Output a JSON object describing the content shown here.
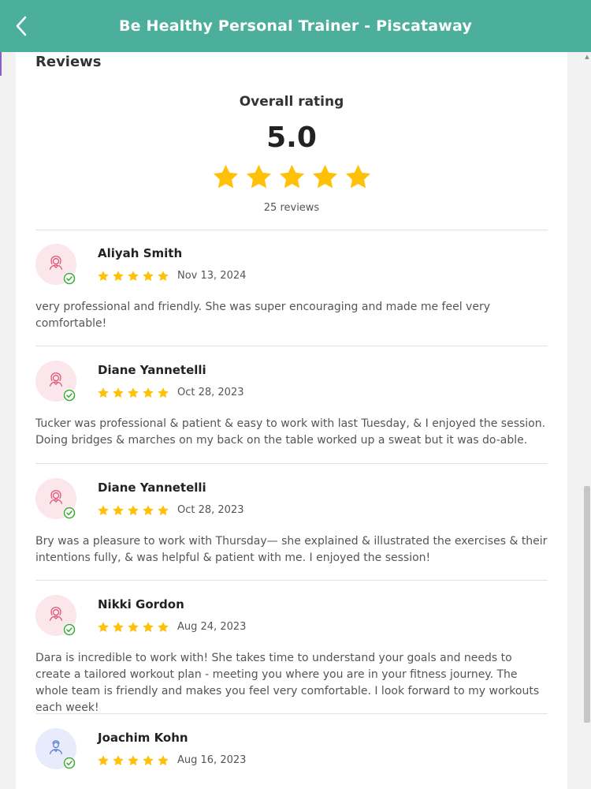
{
  "header": {
    "title": "Be Healthy Personal Trainer - Piscataway"
  },
  "page": {
    "reviews_heading": "Reviews",
    "overall_title": "Overall rating",
    "overall_score": "5.0",
    "overall_stars": 5,
    "overall_count": "25 reviews"
  },
  "colors": {
    "header": "#4caf9b",
    "star": "#ffc107",
    "verified": "#3aaa35"
  },
  "reviews": [
    {
      "name": "Aliyah Smith",
      "date": "Nov 13, 2024",
      "stars": 5,
      "avatar": "female-user-icon",
      "text": "very professional and friendly. She was super encouraging and made me feel very comfortable!"
    },
    {
      "name": "Diane Yannetelli",
      "date": "Oct 28, 2023",
      "stars": 5,
      "avatar": "female-user-icon",
      "text": "Tucker was professional & patient & easy to work with last Tuesday, & I enjoyed the session. Doing bridges & marches on my back on the table worked up a sweat but it was do-able."
    },
    {
      "name": "Diane Yannetelli",
      "date": "Oct 28, 2023",
      "stars": 5,
      "avatar": "female-user-icon",
      "text": "Bry was a pleasure to work with Thursday— she explained & illustrated the exercises & their intentions fully, & was helpful & patient with me. I enjoyed the session!"
    },
    {
      "name": "Nikki Gordon",
      "date": "Aug 24, 2023",
      "stars": 5,
      "avatar": "female-user-icon",
      "text": "Dara is incredible to work with! She takes time to understand your goals and needs to create a tailored workout plan - meeting you where you are in your fitness journey. The whole team is friendly and makes you feel very comfortable. I look forward to my workouts each week!"
    },
    {
      "name": "Joachim Kohn",
      "date": "Aug 16, 2023",
      "stars": 5,
      "avatar": "male-user-icon",
      "text": ""
    }
  ]
}
